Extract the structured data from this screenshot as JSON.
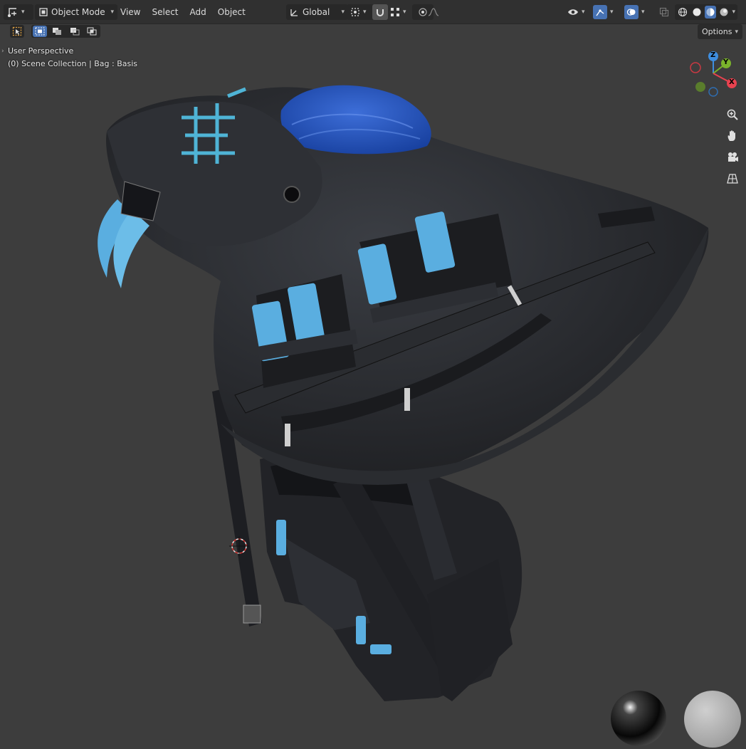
{
  "header": {
    "mode_label": "Object Mode",
    "menus": [
      "View",
      "Select",
      "Add",
      "Object"
    ],
    "transform_orientation": "Global"
  },
  "toolbar": {
    "options_label": "Options"
  },
  "viewport": {
    "view_name": "User Perspective",
    "collection_info": "(0) Scene Collection | Bag : Basis"
  },
  "gizmo": {
    "axis_z": "Z",
    "axis_y": "Y",
    "axis_x": "X"
  },
  "colors": {
    "accent": "#4772b3",
    "axis_x": "#e8424f",
    "axis_y": "#7ab32b",
    "axis_z": "#3e8ee0",
    "cloth_blue": "#5aaee0"
  }
}
